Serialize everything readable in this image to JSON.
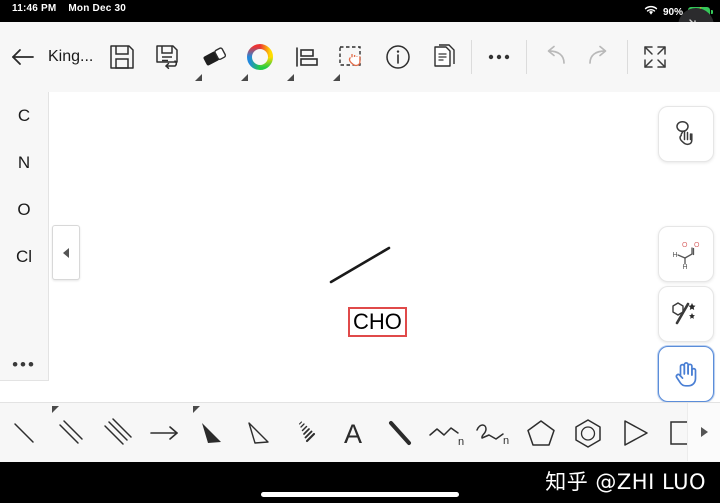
{
  "status_bar": {
    "time": "11:46 PM",
    "date": "Mon Dec 30",
    "wifi_icon": "wifi-icon",
    "battery_percent": "90%",
    "battery_icon": "battery-charging-icon",
    "accent_color": "#35c759"
  },
  "float_button": {
    "name": "minimize-floating-button",
    "icon": "arrows-collapse-icon"
  },
  "toolbar": {
    "back_label": "back-arrow",
    "document_title": "King...",
    "items": [
      {
        "name": "save-button",
        "icon": "floppy-disk-icon",
        "caret": false
      },
      {
        "name": "save-as-button",
        "icon": "floppy-disk-arrow-icon",
        "caret": false
      },
      {
        "name": "eraser-button",
        "icon": "eraser-icon",
        "caret": true
      },
      {
        "name": "color-button",
        "icon": "color-wheel-icon",
        "caret": true
      },
      {
        "name": "align-button",
        "icon": "align-left-icon",
        "caret": true
      },
      {
        "name": "lasso-select-button",
        "icon": "lasso-hand-icon",
        "caret": true
      },
      {
        "name": "info-button",
        "icon": "info-circle-icon",
        "caret": false
      },
      {
        "name": "copy-button",
        "icon": "documents-copy-icon",
        "caret": false
      }
    ],
    "more_label": "more-options",
    "undo_label": "undo",
    "redo_label": "redo",
    "fullscreen_label": "expand-fullscreen"
  },
  "palette": {
    "elements": [
      "C",
      "N",
      "O",
      "Cl"
    ],
    "more_label": "•••",
    "collapse_label": "collapse-palette"
  },
  "canvas": {
    "selected_text": "CHO",
    "selection_color": "#e04a4a",
    "bond_color": "#1a1a1a"
  },
  "right_rail": [
    {
      "name": "lasso-pointer-tool",
      "icon": "lasso-pointing-hand-icon",
      "active": false
    },
    {
      "name": "structure-tool",
      "icon": "molecule-structure-icon",
      "active": false
    },
    {
      "name": "template-magic-tool",
      "icon": "hexagon-pen-stars-icon",
      "active": false
    },
    {
      "name": "pan-tool",
      "icon": "open-hand-icon",
      "active": true
    }
  ],
  "bottom_toolbar": {
    "items": [
      {
        "name": "single-bond-tool",
        "icon": "single-bond-icon",
        "caret": false
      },
      {
        "name": "double-bond-tool",
        "icon": "double-bond-icon",
        "caret": true
      },
      {
        "name": "triple-bond-tool",
        "icon": "triple-bond-icon",
        "caret": false
      },
      {
        "name": "reaction-arrow-tool",
        "icon": "arrow-right-icon",
        "caret": false
      },
      {
        "name": "bold-wedge-tool",
        "icon": "solid-wedge-icon",
        "caret": true
      },
      {
        "name": "hollow-wedge-tool",
        "icon": "hollow-wedge-icon",
        "caret": false
      },
      {
        "name": "hashed-wedge-tool",
        "icon": "hashed-wedge-icon",
        "caret": false
      },
      {
        "name": "text-tool",
        "icon": "letter-a-icon",
        "caret": false
      },
      {
        "name": "thick-bond-tool",
        "icon": "bold-bond-icon",
        "caret": false
      },
      {
        "name": "chain-tool",
        "icon": "zigzag-chain-n-icon",
        "caret": false
      },
      {
        "name": "polymer-chain-tool",
        "icon": "curly-chain-n-icon",
        "caret": false
      },
      {
        "name": "cyclopentane-tool",
        "icon": "pentagon-ring-icon",
        "caret": false
      },
      {
        "name": "benzene-tool",
        "icon": "benzene-ring-icon",
        "caret": false
      },
      {
        "name": "cyclopropane-tool",
        "icon": "triangle-ring-icon",
        "caret": false
      },
      {
        "name": "cyclobutane-tool",
        "icon": "square-ring-icon",
        "caret": false
      }
    ],
    "scroll_label": "scroll-right"
  },
  "footer": {
    "watermark": "知乎 @ZHI LUO"
  }
}
